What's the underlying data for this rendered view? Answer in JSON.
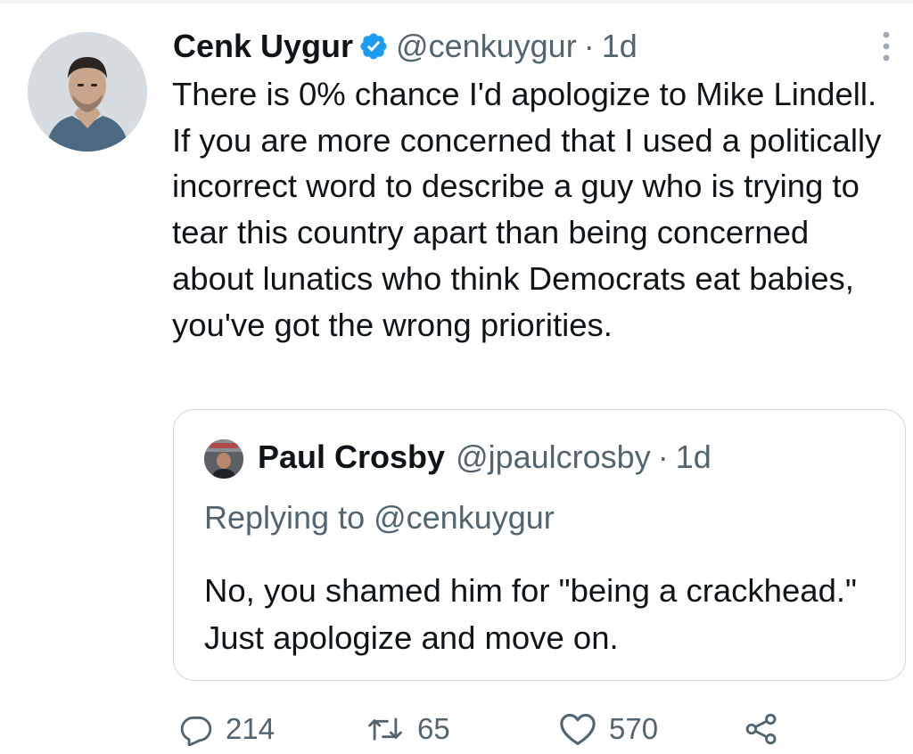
{
  "tweet": {
    "author": {
      "name": "Cenk Uygur",
      "handle": "@cenkuygur",
      "verified": true
    },
    "separator": "·",
    "time": "1d",
    "text": "There is 0% chance I'd apologize to Mike Lindell. If you are more concerned that I used a politically incorrect word to describe a guy who is trying to tear this country apart than being concerned about lunatics who think Democrats eat babies, you've got the wrong priorities."
  },
  "quote": {
    "author": {
      "name": "Paul Crosby",
      "handle": "@jpaulcrosby"
    },
    "separator": "·",
    "time": "1d",
    "replying_to": "Replying to @cenkuygur",
    "text": "No,  you shamed him for \"being a crackhead.\" Just apologize and move on."
  },
  "actions": {
    "reply_count": "214",
    "retweet_count": "65",
    "like_count": "570"
  },
  "icons": {
    "verified": "verified-badge-icon",
    "more": "more-vertical-icon",
    "reply": "reply-icon",
    "retweet": "retweet-icon",
    "like": "heart-icon",
    "share": "share-icon"
  },
  "colors": {
    "text": "#0f1419",
    "secondary": "#536471",
    "verified": "#1d9bf0",
    "border": "#cfd9de"
  }
}
